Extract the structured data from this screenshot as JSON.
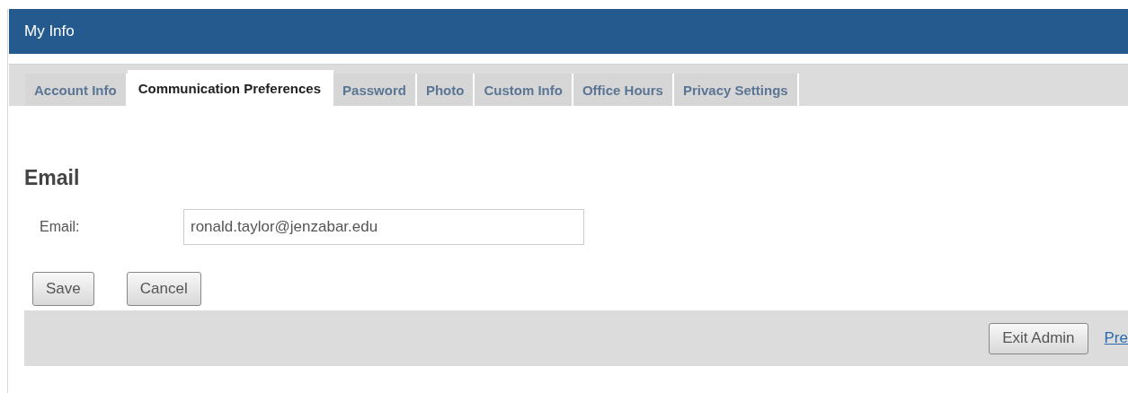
{
  "header": {
    "title": "My Info"
  },
  "tabs": [
    {
      "label": "Account Info",
      "selected": false
    },
    {
      "label": "Communication Preferences",
      "selected": true
    },
    {
      "label": "Password",
      "selected": false
    },
    {
      "label": "Photo",
      "selected": false
    },
    {
      "label": "Custom Info",
      "selected": false
    },
    {
      "label": "Office Hours",
      "selected": false
    },
    {
      "label": "Privacy Settings",
      "selected": false
    }
  ],
  "section": {
    "heading": "Email",
    "fields": [
      {
        "label": "Email:",
        "value": "ronald.taylor@jenzabar.edu"
      }
    ],
    "buttons": [
      "Save",
      "Cancel"
    ]
  },
  "footer": {
    "button": "Exit Admin",
    "link": "Pre"
  }
}
